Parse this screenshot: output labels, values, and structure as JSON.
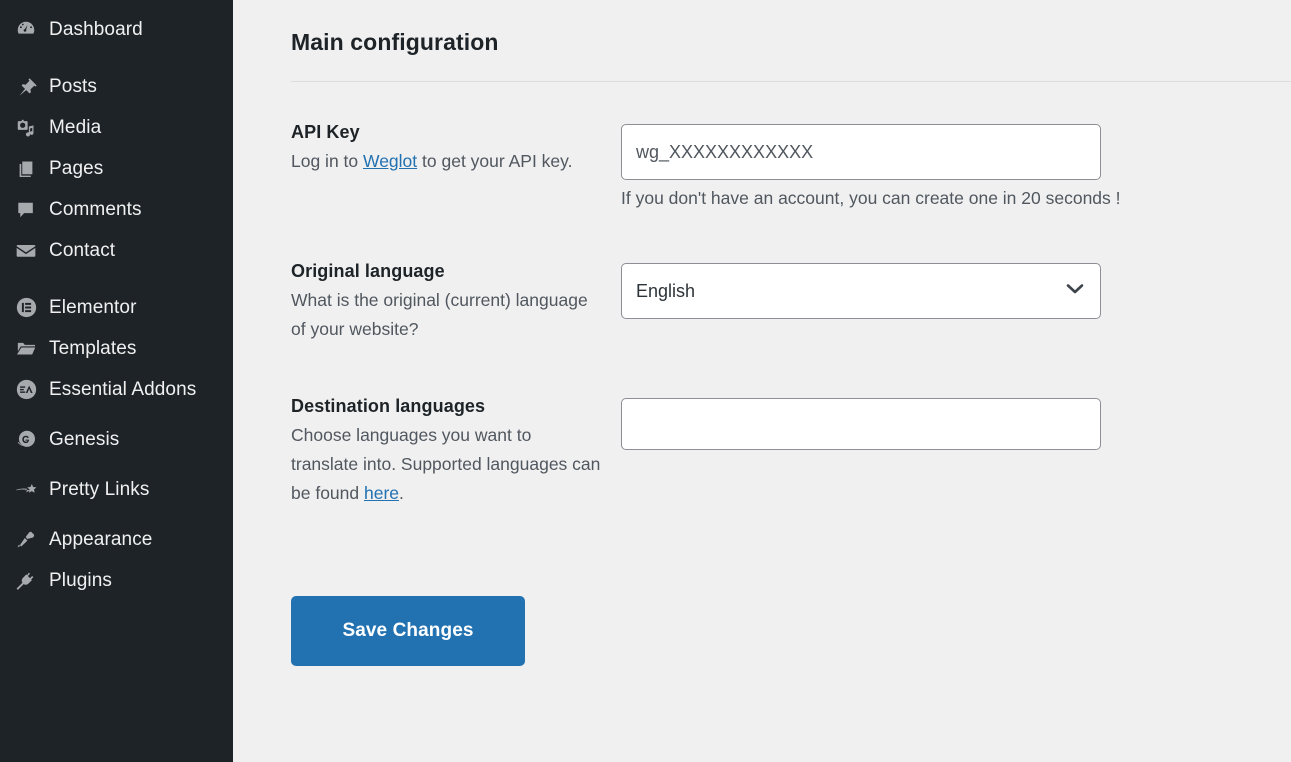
{
  "sidebar": {
    "items": [
      {
        "label": "Dashboard",
        "icon": "dashboard-gauge-icon",
        "name": "dashboard",
        "gap_after": "large"
      },
      {
        "label": "Posts",
        "icon": "pushpin-icon",
        "name": "posts",
        "gap_after": "none"
      },
      {
        "label": "Media",
        "icon": "media-camera-music-icon",
        "name": "media",
        "gap_after": "none"
      },
      {
        "label": "Pages",
        "icon": "pages-stack-icon",
        "name": "pages",
        "gap_after": "none"
      },
      {
        "label": "Comments",
        "icon": "comment-bubble-icon",
        "name": "comments",
        "gap_after": "none"
      },
      {
        "label": "Contact",
        "icon": "envelope-icon",
        "name": "contact",
        "gap_after": "large"
      },
      {
        "label": "Elementor",
        "icon": "elementor-circle-icon",
        "name": "elementor",
        "gap_after": "none"
      },
      {
        "label": "Templates",
        "icon": "folder-icon",
        "name": "templates",
        "gap_after": "none"
      },
      {
        "label": "Essential Addons",
        "icon": "essential-addons-circle-icon",
        "name": "essential-addons",
        "gap_after": "small"
      },
      {
        "label": "Genesis",
        "icon": "genesis-circle-icon",
        "name": "genesis",
        "gap_after": "small"
      },
      {
        "label": "Pretty Links",
        "icon": "pretty-links-arrow-star-icon",
        "name": "pretty-links",
        "gap_after": "small"
      },
      {
        "label": "Appearance",
        "icon": "paintbrush-icon",
        "name": "appearance",
        "gap_after": "none"
      },
      {
        "label": "Plugins",
        "icon": "plug-icon",
        "name": "plugins",
        "gap_after": "none"
      }
    ]
  },
  "main": {
    "page_title": "Main configuration",
    "fields": {
      "api_key": {
        "title": "API Key",
        "desc_before": "Log in to ",
        "desc_link": "Weglot",
        "desc_after": " to get your API key.",
        "value": "wg_XXXXXXXXXXXX",
        "placeholder": "",
        "helper": "If you don't have an account, you can create one in 20 seconds !"
      },
      "original_language": {
        "title": "Original language",
        "desc": "What is the original (current) language of your website?",
        "selected": "English",
        "options": [
          "English"
        ]
      },
      "destination_languages": {
        "title": "Destination languages",
        "desc_before": "Choose languages you want to translate into. Supported languages can be found ",
        "desc_link": "here",
        "desc_after": ".",
        "value": "",
        "placeholder": ""
      }
    },
    "save_label": "Save Changes"
  },
  "colors": {
    "sidebar_bg": "#1d2327",
    "main_bg": "#f0f0f1",
    "accent_blue": "#2271b1",
    "link_blue": "#2271b1",
    "text_dark": "#1d2327",
    "text_muted": "#50575e",
    "border_gray": "#8c8f94"
  }
}
